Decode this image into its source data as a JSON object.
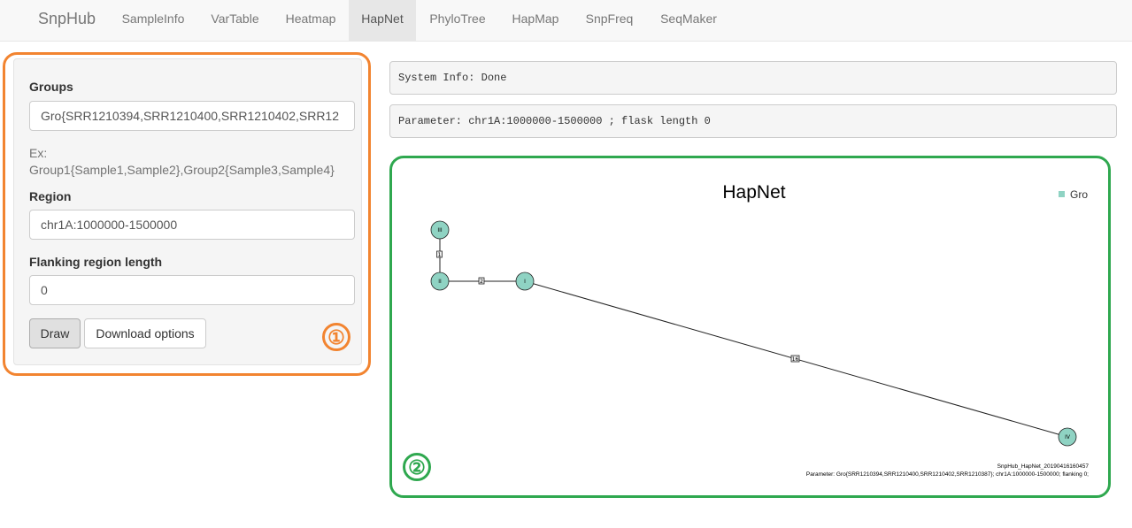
{
  "navbar": {
    "brand": "SnpHub",
    "tabs": [
      {
        "label": "SampleInfo"
      },
      {
        "label": "VarTable"
      },
      {
        "label": "Heatmap"
      },
      {
        "label": "HapNet",
        "active": true
      },
      {
        "label": "PhyloTree"
      },
      {
        "label": "HapMap"
      },
      {
        "label": "SnpFreq"
      },
      {
        "label": "SeqMaker"
      }
    ]
  },
  "form": {
    "groups_label": "Groups",
    "groups_value": "Gro{SRR1210394,SRR1210400,SRR1210402,SRR12",
    "example_prefix": "Ex:",
    "example_text": "Group1{Sample1,Sample2},Group2{Sample3,Sample4}",
    "region_label": "Region",
    "region_value": "chr1A:1000000-1500000",
    "flanking_label": "Flanking region length",
    "flanking_value": "0",
    "draw_button": "Draw",
    "download_button": "Download options"
  },
  "annotations": {
    "marker_1": "①",
    "marker_2": "②"
  },
  "output": {
    "system_info": "System Info: Done",
    "parameter": "Parameter: chr1A:1000000-1500000 ; flask length 0"
  },
  "plot": {
    "title": "HapNet",
    "legend_label": "Gro",
    "legend_color": "#8fd3c3",
    "nodes": [
      {
        "label": "III"
      },
      {
        "label": "II"
      },
      {
        "label": "I"
      },
      {
        "label": "IV"
      }
    ],
    "edges": [
      {
        "from": "III",
        "to": "II",
        "mutations": "1"
      },
      {
        "from": "II",
        "to": "I",
        "mutations": "2"
      },
      {
        "from": "I",
        "to": "IV",
        "mutations": "16"
      }
    ],
    "footer_line1": "SnpHub_HapNet_20190416160457",
    "footer_line2": "Parameter: Gro{SRR1210394,SRR1210400,SRR1210402,SRR1210387}; chr1A:1000000-1500000; flanking 0;"
  },
  "colors": {
    "highlight_orange": "#f28430",
    "highlight_green": "#2fa84f",
    "node_fill": "#8fd3c3"
  }
}
